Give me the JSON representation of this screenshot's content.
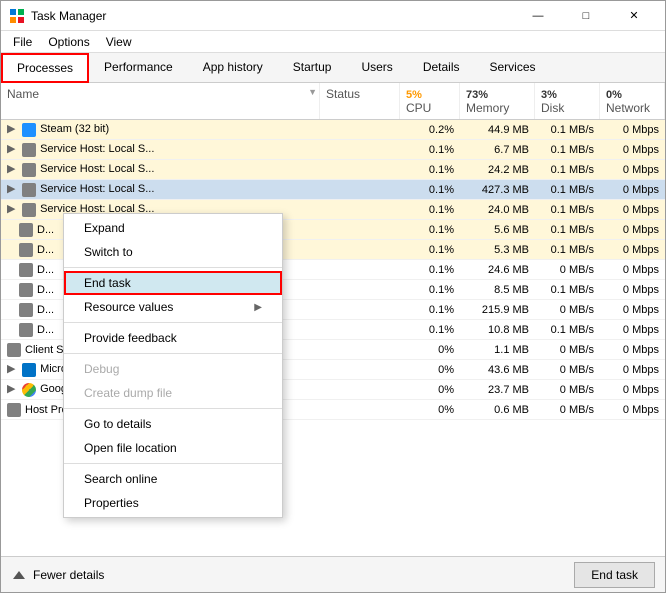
{
  "window": {
    "title": "Task Manager",
    "min_btn": "—",
    "max_btn": "□",
    "close_btn": "✕"
  },
  "menu": {
    "items": [
      "File",
      "Options",
      "View"
    ]
  },
  "tabs": [
    {
      "label": "Processes",
      "active": true,
      "highlighted": true
    },
    {
      "label": "Performance"
    },
    {
      "label": "App history"
    },
    {
      "label": "Startup"
    },
    {
      "label": "Users"
    },
    {
      "label": "Details"
    },
    {
      "label": "Services"
    }
  ],
  "table": {
    "columns": [
      {
        "label": "Name"
      },
      {
        "label": "Status"
      },
      {
        "label": "CPU",
        "value": "5%",
        "accent": true
      },
      {
        "label": "Memory",
        "value": "73%"
      },
      {
        "label": "Disk",
        "value": "3%"
      },
      {
        "label": "Network",
        "value": "0%"
      }
    ],
    "rows": [
      {
        "name": "Steam (32 bit)",
        "status": "",
        "cpu": "0.2%",
        "memory": "44.9 MB",
        "disk": "0.1 MB/s",
        "network": "0 Mbps",
        "expand": true,
        "icon": "blue"
      },
      {
        "name": "Service Host: Local S...",
        "status": "",
        "cpu": "0.1%",
        "memory": "6.7 MB",
        "disk": "0.1 MB/s",
        "network": "0 Mbps",
        "expand": true,
        "icon": "gray"
      },
      {
        "name": "Service Host: Local S...",
        "status": "",
        "cpu": "0.1%",
        "memory": "24.2 MB",
        "disk": "0.1 MB/s",
        "network": "0 Mbps",
        "expand": true,
        "icon": "gray"
      },
      {
        "name": "Service Host: Local S...",
        "status": "",
        "cpu": "0.1%",
        "memory": "427.3 MB",
        "disk": "0.1 MB/s",
        "network": "0 Mbps",
        "expand": true,
        "icon": "gray",
        "selected": true
      },
      {
        "name": "Service Host: Local S...",
        "status": "",
        "cpu": "0.1%",
        "memory": "24.0 MB",
        "disk": "0.1 MB/s",
        "network": "0 Mbps",
        "expand": true,
        "icon": "gray"
      },
      {
        "name": "D...",
        "status": "",
        "cpu": "0.1%",
        "memory": "5.6 MB",
        "disk": "0.1 MB/s",
        "network": "0 Mbps",
        "expand": false,
        "icon": "gray"
      },
      {
        "name": "D...",
        "status": "",
        "cpu": "0.1%",
        "memory": "5.3 MB",
        "disk": "0.1 MB/s",
        "network": "0 Mbps",
        "expand": false,
        "icon": "gray"
      },
      {
        "name": "D...",
        "status": "",
        "cpu": "0.1%",
        "memory": "24.6 MB",
        "disk": "0 MB/s",
        "network": "0 Mbps",
        "expand": false,
        "icon": "gray"
      },
      {
        "name": "D...",
        "status": "",
        "cpu": "0.1%",
        "memory": "8.5 MB",
        "disk": "0.1 MB/s",
        "network": "0 Mbps",
        "expand": false,
        "icon": "gray"
      },
      {
        "name": "D...",
        "status": "",
        "cpu": "0.1%",
        "memory": "215.9 MB",
        "disk": "0 MB/s",
        "network": "0 Mbps",
        "expand": false,
        "icon": "gray"
      },
      {
        "name": "D...",
        "status": "",
        "cpu": "0.1%",
        "memory": "10.8 MB",
        "disk": "0.1 MB/s",
        "network": "0 Mbps",
        "expand": false,
        "icon": "gray"
      },
      {
        "name": "Client Server Runtime Process",
        "status": "",
        "cpu": "0%",
        "memory": "1.1 MB",
        "disk": "0 MB/s",
        "network": "0 Mbps",
        "expand": false,
        "icon": "gray"
      },
      {
        "name": "Microsoft Outlook",
        "status": "",
        "cpu": "0%",
        "memory": "43.6 MB",
        "disk": "0 MB/s",
        "network": "0 Mbps",
        "expand": true,
        "icon": "outlook"
      },
      {
        "name": "Google Chrome",
        "status": "",
        "cpu": "0%",
        "memory": "23.7 MB",
        "disk": "0 MB/s",
        "network": "0 Mbps",
        "expand": true,
        "icon": "chrome"
      },
      {
        "name": "Host Process for Windows Tasks",
        "status": "",
        "cpu": "0%",
        "memory": "0.6 MB",
        "disk": "0 MB/s",
        "network": "0 Mbps",
        "expand": false,
        "icon": "gray"
      }
    ]
  },
  "context_menu": {
    "items": [
      {
        "label": "Expand",
        "disabled": false,
        "separator_after": false
      },
      {
        "label": "Switch to",
        "disabled": false,
        "separator_after": true
      },
      {
        "label": "End task",
        "disabled": false,
        "highlighted": true,
        "separator_after": false
      },
      {
        "label": "Resource values",
        "disabled": false,
        "has_arrow": true,
        "separator_after": true
      },
      {
        "label": "Provide feedback",
        "disabled": false,
        "separator_after": true
      },
      {
        "label": "Debug",
        "disabled": true,
        "separator_after": false
      },
      {
        "label": "Create dump file",
        "disabled": true,
        "separator_after": true
      },
      {
        "label": "Go to details",
        "disabled": false,
        "separator_after": false
      },
      {
        "label": "Open file location",
        "disabled": false,
        "separator_after": true
      },
      {
        "label": "Search online",
        "disabled": false,
        "separator_after": false
      },
      {
        "label": "Properties",
        "disabled": false,
        "separator_after": false
      }
    ]
  },
  "bottom_bar": {
    "fewer_details": "Fewer details",
    "end_task": "End task"
  }
}
